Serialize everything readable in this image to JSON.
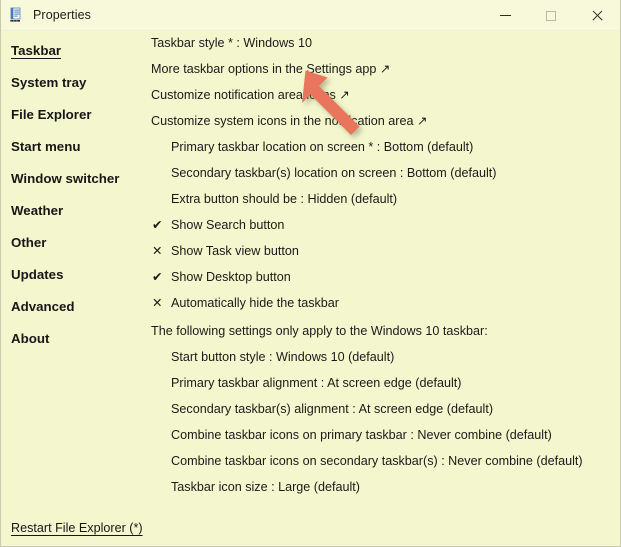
{
  "window": {
    "title": "Properties",
    "icon": "properties-icon",
    "background_color": "#f4f7cd",
    "titlebar_color": "#f8f9da",
    "controls": {
      "minimize_label": "—",
      "maximize_label": "□",
      "close_label": "✕"
    }
  },
  "sidebar": {
    "items": [
      {
        "label": "Taskbar",
        "selected": true
      },
      {
        "label": "System tray",
        "selected": false
      },
      {
        "label": "File Explorer",
        "selected": false
      },
      {
        "label": "Start menu",
        "selected": false
      },
      {
        "label": "Window switcher",
        "selected": false
      },
      {
        "label": "Weather",
        "selected": false
      },
      {
        "label": "Other",
        "selected": false
      },
      {
        "label": "Updates",
        "selected": false
      },
      {
        "label": "Advanced",
        "selected": false
      },
      {
        "label": "About",
        "selected": false
      }
    ]
  },
  "main": {
    "top_settings": [
      {
        "text": "Taskbar style * : Windows 10",
        "type": "setting"
      },
      {
        "text": "More taskbar options in the Settings app ↗",
        "type": "link"
      },
      {
        "text": "Customize notification area icons ↗",
        "type": "link"
      },
      {
        "text": "Customize system icons in the notification area ↗",
        "type": "link"
      }
    ],
    "indented_settings": [
      {
        "text": "Primary taskbar location on screen * : Bottom (default)"
      },
      {
        "text": "Secondary taskbar(s) location on screen : Bottom (default)"
      },
      {
        "text": "Extra button should be : Hidden (default)"
      }
    ],
    "checkbox_settings": [
      {
        "mark": "✔",
        "checked": true,
        "text": "Show Search button"
      },
      {
        "mark": "✕",
        "checked": false,
        "text": "Show Task view button"
      },
      {
        "mark": "✔",
        "checked": true,
        "text": "Show Desktop button"
      },
      {
        "mark": "✕",
        "checked": false,
        "text": "Automatically hide the taskbar"
      }
    ],
    "section_note": "The following settings only apply to the Windows 10 taskbar:",
    "section_settings": [
      {
        "text": "Start button style : Windows 10 (default)"
      },
      {
        "text": "Primary taskbar alignment : At screen edge (default)"
      },
      {
        "text": "Secondary taskbar(s) alignment : At screen edge (default)"
      },
      {
        "text": "Combine taskbar icons on primary taskbar : Never combine (default)"
      },
      {
        "text": "Combine taskbar icons on secondary taskbar(s) : Never combine (default)"
      },
      {
        "text": "Taskbar icon size : Large (default)"
      }
    ]
  },
  "footer": {
    "restart_label": "Restart File Explorer (*)"
  },
  "annotation": {
    "type": "arrow",
    "color": "#e8755c",
    "direction": "up-left",
    "points_at": "Taskbar style * : Windows 10"
  }
}
